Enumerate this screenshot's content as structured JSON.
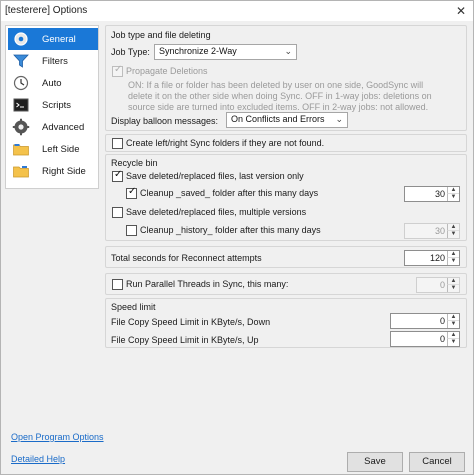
{
  "window": {
    "title": "[testerere] Options",
    "close_icon": "close-icon"
  },
  "sidebar": {
    "items": [
      {
        "label": "General",
        "icon": "gear-icon",
        "selected": true
      },
      {
        "label": "Filters",
        "icon": "filter-funnel-icon"
      },
      {
        "label": "Auto",
        "icon": "auto-clock-icon"
      },
      {
        "label": "Scripts",
        "icon": "script-terminal-icon"
      },
      {
        "label": "Advanced",
        "icon": "gear-advanced-icon"
      },
      {
        "label": "Left Side",
        "icon": "folder-left-icon"
      },
      {
        "label": "Right Side",
        "icon": "folder-right-icon"
      }
    ]
  },
  "job": {
    "section_title": "Job type and file deleting",
    "job_type_label": "Job Type:",
    "job_type_value": "Synchronize 2-Way",
    "propagate_label": "Propagate Deletions",
    "info_line1": "ON: If a file or folder has been deleted by user on one side, GoodSync will",
    "info_line2": "delete it on the other side when doing Sync.  OFF in 1-way jobs: deletions on",
    "info_line3": "source side are turned into excluded items.  OFF in 2-way jobs: not allowed.",
    "balloon_label": "Display balloon messages:",
    "balloon_value": "On Conflicts and Errors"
  },
  "create_folders": {
    "label": "Create left/right Sync folders if they are not found.",
    "checked": false
  },
  "recycle": {
    "section_title": "Recycle bin",
    "save_last_label": "Save deleted/replaced files, last version only",
    "save_last_checked": true,
    "cleanup_saved_label": "Cleanup _saved_ folder after this many days",
    "cleanup_saved_checked": true,
    "cleanup_saved_value": "30",
    "save_multi_label": "Save deleted/replaced files, multiple versions",
    "save_multi_checked": false,
    "cleanup_history_label": "Cleanup _history_ folder after this many days",
    "cleanup_history_checked": false,
    "cleanup_history_value": "30"
  },
  "reconnect": {
    "label": "Total seconds for Reconnect attempts",
    "value": "120"
  },
  "parallel": {
    "label": "Run Parallel Threads in Sync, this many:",
    "checked": false,
    "value": "0"
  },
  "speed": {
    "section_title": "Speed limit",
    "down_label": "File Copy Speed Limit in KByte/s, Down",
    "down_value": "0",
    "up_label": "File Copy Speed Limit in KByte/s, Up",
    "up_value": "0"
  },
  "footer": {
    "open_program_options": "Open Program Options",
    "detailed_help": "Detailed Help",
    "save": "Save",
    "cancel": "Cancel"
  },
  "colors": {
    "selection": "#1a78d7",
    "link": "#1a6bc8"
  }
}
